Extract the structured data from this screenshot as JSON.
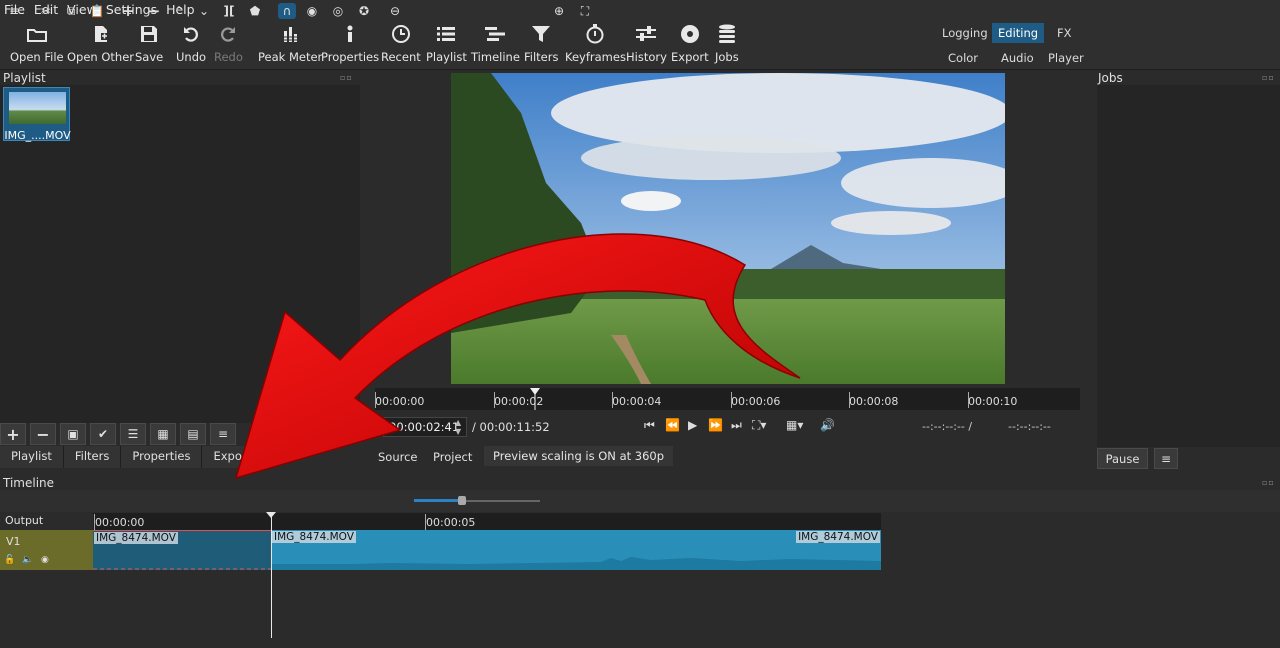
{
  "menu": [
    "File",
    "Edit",
    "View",
    "Settings",
    "Help"
  ],
  "toolbar": {
    "buttons": [
      {
        "label": "Open File",
        "icon": "open-file-icon"
      },
      {
        "label": "Open Other",
        "icon": "open-other-icon"
      },
      {
        "label": "Save",
        "icon": "save-icon"
      },
      {
        "label": "Undo",
        "icon": "undo-icon"
      },
      {
        "label": "Redo",
        "icon": "redo-icon",
        "disabled": true
      },
      {
        "label": "Peak Meter",
        "icon": "peak-meter-icon"
      },
      {
        "label": "Properties",
        "icon": "properties-icon"
      },
      {
        "label": "Recent",
        "icon": "recent-icon"
      },
      {
        "label": "Playlist",
        "icon": "playlist-icon"
      },
      {
        "label": "Timeline",
        "icon": "timeline-icon"
      },
      {
        "label": "Filters",
        "icon": "filters-icon"
      },
      {
        "label": "Keyframes",
        "icon": "keyframes-icon"
      },
      {
        "label": "History",
        "icon": "history-icon"
      },
      {
        "label": "Export",
        "icon": "export-icon"
      },
      {
        "label": "Jobs",
        "icon": "jobs-icon"
      }
    ]
  },
  "layouts": {
    "logging": "Logging",
    "editing": "Editing",
    "fx": "FX",
    "color": "Color",
    "audio": "Audio",
    "player": "Player",
    "active": "Editing"
  },
  "playlist": {
    "title": "Playlist",
    "items": [
      {
        "label": "IMG_....MOV"
      }
    ],
    "tabs": [
      "Playlist",
      "Filters",
      "Properties",
      "Export"
    ]
  },
  "player": {
    "ruler_ticks": [
      "00:00:00",
      "00:00:02",
      "00:00:04",
      "00:00:06",
      "00:00:08",
      "00:00:10"
    ],
    "current_time": "00:00:02:41",
    "total_time": "/ 00:00:11:52",
    "in_point": "--:--:--:-- /",
    "out_point": "--:--:--:--",
    "tabs": {
      "source": "Source",
      "project": "Project"
    },
    "preview_note": "Preview scaling is ON at 360p"
  },
  "jobs": {
    "title": "Jobs",
    "pause": "Pause"
  },
  "timeline": {
    "title": "Timeline",
    "output_label": "Output",
    "track_name": "V1",
    "ruler_ticks": [
      "00:00:00",
      "00:00:05"
    ],
    "clips": [
      {
        "label": "IMG_8474.MOV"
      },
      {
        "label": "IMG_8474.MOV"
      },
      {
        "label": "IMG_8474.MOV"
      }
    ],
    "snap_active": true,
    "zoom_level": 0.38
  },
  "colors": {
    "accent": "#1f5c85",
    "clip": "#2a8fb8",
    "track_header": "#6b6b2a",
    "annotation_arrow": "#dd0000"
  }
}
